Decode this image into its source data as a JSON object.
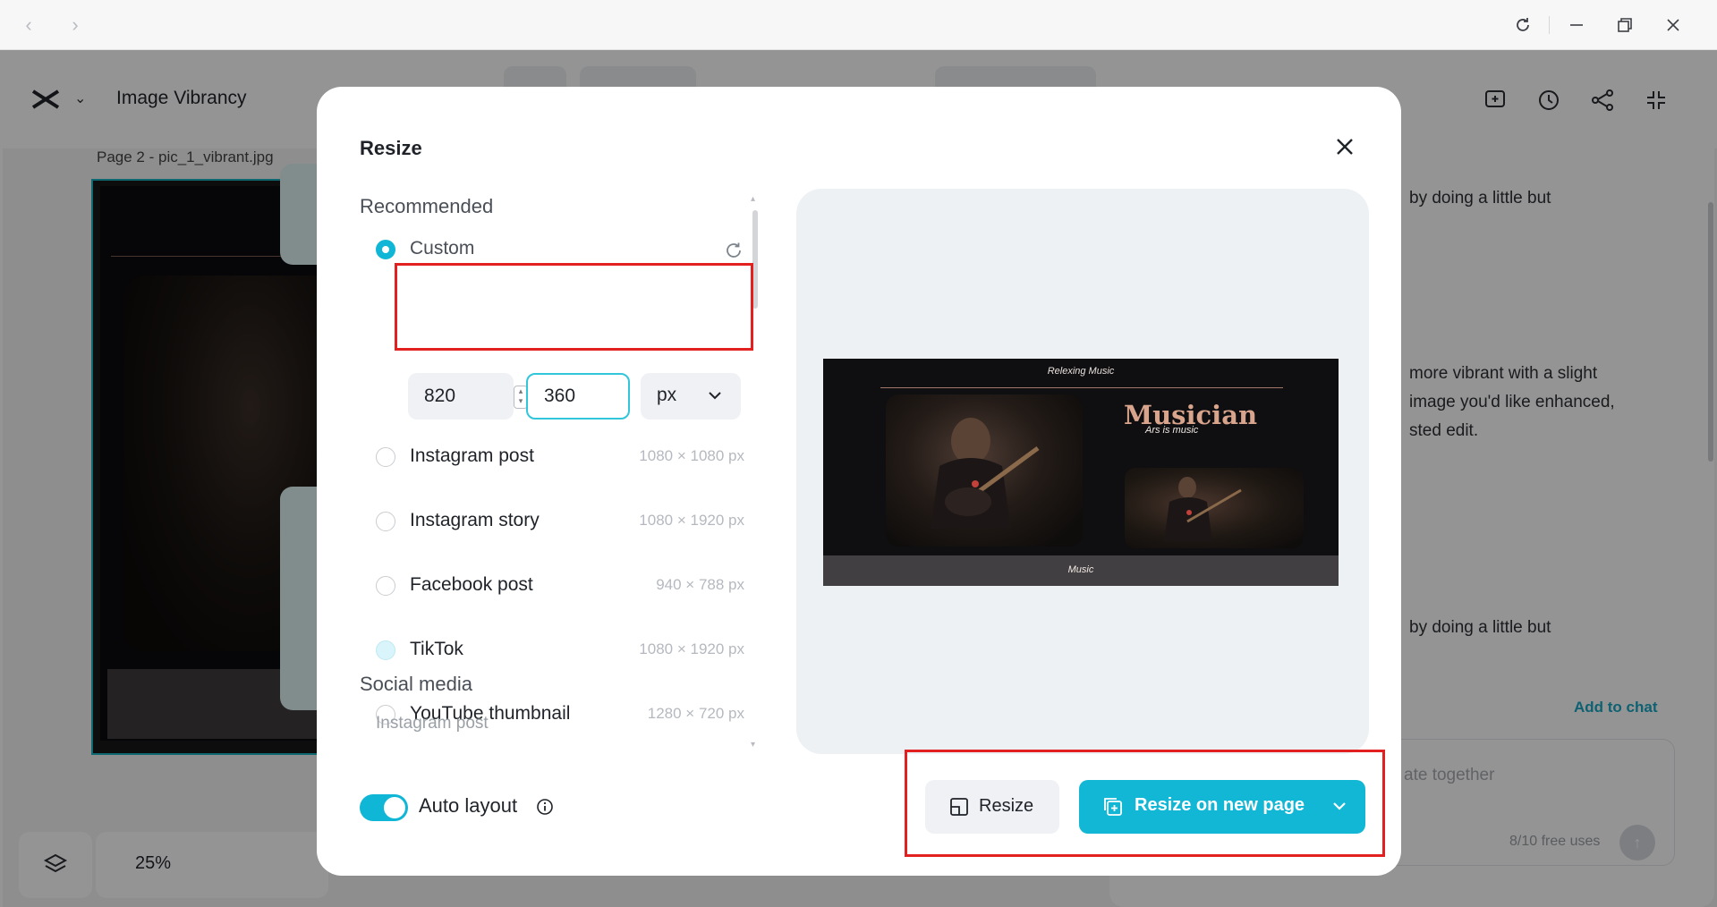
{
  "browser": {
    "back_icon": "chevron-left-icon",
    "forward_icon": "chevron-right-icon",
    "refresh_icon": "refresh-icon",
    "minimize_icon": "minimize-icon",
    "restore_icon": "restore-icon",
    "close_icon": "close-icon"
  },
  "app": {
    "title": "Image Vibrancy",
    "page_label": "Page 2 -  pic_1_vibrant.jpg",
    "zoom": "25%",
    "chat": {
      "bubble1": "by doing a little but",
      "body_line1": "more vibrant with a slight",
      "body_line2": "image you'd like enhanced,",
      "body_line3": "sted edit.",
      "bubble2": "by doing a little but",
      "add_to_chat": "Add to chat",
      "input_placeholder": "ate together",
      "free_uses": "8/10 free uses"
    }
  },
  "modal": {
    "title": "Resize",
    "recommended_heading": "Recommended",
    "custom": {
      "label": "Custom",
      "width": "820",
      "height": "360",
      "unit": "px"
    },
    "presets": [
      {
        "label": "Instagram post",
        "size": "1080 × 1080 px"
      },
      {
        "label": "Instagram story",
        "size": "1080 × 1920 px"
      },
      {
        "label": "Facebook post",
        "size": "940 × 788 px"
      },
      {
        "label": "TikTok",
        "size": "1080 × 1920 px"
      },
      {
        "label": "YouTube thumbnail",
        "size": "1280 × 720 px"
      }
    ],
    "social_heading": "Social media",
    "social_first_item": "Instagram post",
    "auto_layout_label": "Auto layout",
    "auto_layout_on": true,
    "preview": {
      "header_text": "Relexing Music",
      "title": "Musician",
      "subtitle": "Ars is music",
      "footer_text": "Music"
    },
    "resize_button": "Resize",
    "resize_new_page_button": "Resize on new page"
  },
  "colors": {
    "accent": "#12b7d5",
    "highlight_box": "#e2201f"
  }
}
